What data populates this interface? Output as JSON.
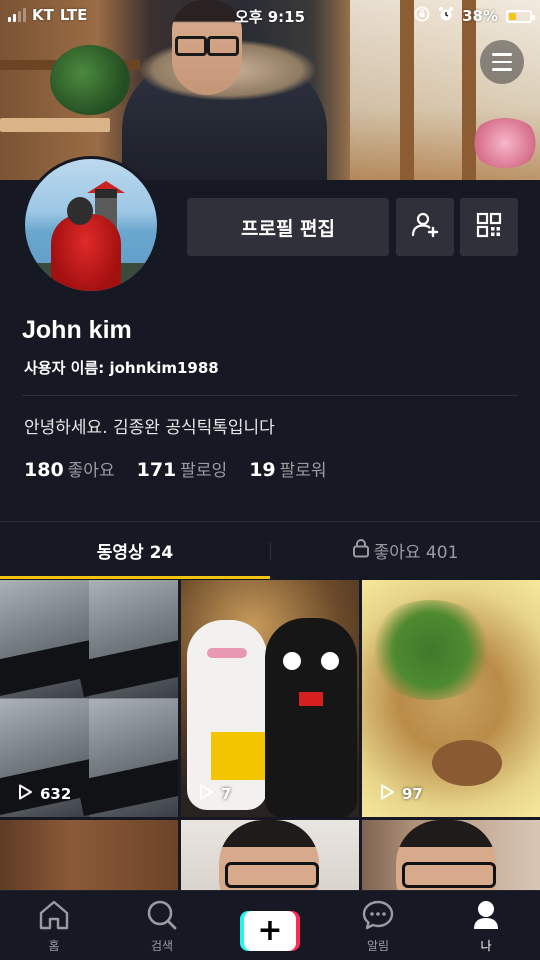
{
  "status_bar": {
    "carrier": "KT",
    "network": "LTE",
    "time": "오후 9:15",
    "battery": "38%",
    "battery_level": 0.38
  },
  "profile": {
    "edit_button": "프로필 편집",
    "display_name": "John kim",
    "username_label": "사용자 이름: johnkim1988",
    "bio": "안녕하세요. 김종완 공식틱톡입니다"
  },
  "stats": [
    {
      "value": "180",
      "label": "좋아요"
    },
    {
      "value": "171",
      "label": "팔로잉"
    },
    {
      "value": "19",
      "label": "팔로워"
    }
  ],
  "tabs": {
    "videos": "동영상 24",
    "likes": "좋아요 401"
  },
  "videos": [
    {
      "views": "632"
    },
    {
      "views": "7"
    },
    {
      "views": "97"
    }
  ],
  "bottom_nav": {
    "home": "홈",
    "search": "검색",
    "create": "+",
    "inbox": "알림",
    "me": "나"
  },
  "colors": {
    "background": "#161823",
    "button": "#2f3039",
    "tab_indicator": "#f1c40f",
    "create_cyan": "#25f4ee",
    "create_red": "#fe2c55"
  },
  "icons": [
    "menu-icon",
    "add-friend-icon",
    "qr-code-icon",
    "lock-icon",
    "play-icon",
    "home-icon",
    "search-icon",
    "create-icon",
    "inbox-icon",
    "profile-icon",
    "alarm-icon",
    "rotation-lock-icon",
    "battery-icon",
    "signal-icon"
  ]
}
